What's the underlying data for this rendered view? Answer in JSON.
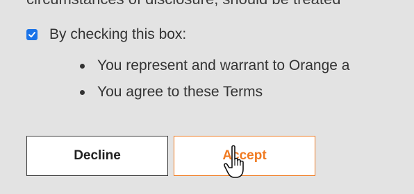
{
  "terms": {
    "clipped_line": "circumstances of disclosure, should be treated"
  },
  "consent": {
    "checked": true,
    "label": "By checking this box:",
    "bullets": [
      "You represent and warrant to Orange a",
      "You agree to these Terms"
    ]
  },
  "actions": {
    "decline_label": "Decline",
    "accept_label": "Accept"
  },
  "colors": {
    "checkbox": "#1a73e8",
    "accent": "#f07b22",
    "background": "#e3e3e3"
  },
  "cursor": {
    "icon": "hand-pointer-icon"
  }
}
